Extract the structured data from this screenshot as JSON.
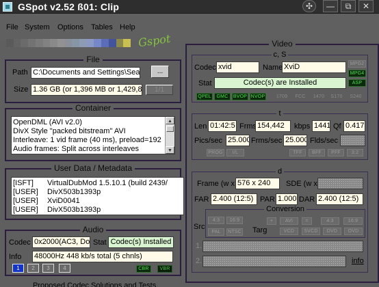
{
  "window": {
    "title": "GSpot v2.52 ß01: Clip",
    "help_glyph": "✣",
    "min_glyph": "—",
    "max_glyph": "⧉",
    "close_glyph": "✕"
  },
  "menu": {
    "file": "File",
    "system": "System",
    "options": "Options",
    "tables": "Tables",
    "help": "Help"
  },
  "colors": {
    "colorbar": [
      "#5a5a5a",
      "#636363",
      "#6b6b6b",
      "#737373",
      "#7a7a7a",
      "#828282",
      "#8a8a8a",
      "#929292",
      "#8a8f9a",
      "#8696a6",
      "#8e9bb5",
      "#8a98c3",
      "#7788c8",
      "#5b6db8",
      "#44549c",
      "#8c8a4a",
      "#c8c050"
    ],
    "logo": "#86c53f"
  },
  "logo": "Gspot",
  "file": {
    "title": "File",
    "path_label": "Path",
    "path_value": "C:\\Documents and Settings\\Sea",
    "browse_label": "...",
    "size_label": "Size",
    "size_value": "1.36 GB (or 1,396 MB or 1,429,85",
    "part_label": "1/1"
  },
  "container": {
    "title": "Container",
    "lines": [
      "OpenDML (AVI v2.0)",
      "DivX Style \"packed bitstream\" AVI",
      "Interleave: 1 vid frame (40 ms), preload=192",
      "Audio frames: Split across interleaves"
    ]
  },
  "metadata": {
    "title": "User Data / Metadata",
    "rows": [
      {
        "tag": "[ISFT]",
        "value": "VirtualDubMod 1.5.10.1 (build 2439/"
      },
      {
        "tag": "[USER]",
        "value": "DivX503b1393p"
      },
      {
        "tag": "[USER]",
        "value": "XviD0041"
      },
      {
        "tag": "[USER]",
        "value": "DivX503b1393p"
      }
    ]
  },
  "audio": {
    "title": "Audio",
    "codec_label": "Codec",
    "codec_value": "0x2000(AC3, Dol",
    "stat_label": "Stat",
    "stat_value": "Codec(s) Installed",
    "info_label": "Info",
    "info_value": "48000Hz  448 kb/s total (5 chnls)",
    "stream_buttons": [
      "1",
      "2",
      "3",
      "4"
    ],
    "cbr": "CBR",
    "vbr": "VBR"
  },
  "bottom_text": "Proposed Codec Solutions and Tests",
  "video": {
    "title": "Video",
    "cs": {
      "title": "c, S",
      "codec_label": "Codec",
      "codec_value": "xvid",
      "name_label": "Name",
      "name_value": "XviD",
      "stat_label": "Stat",
      "stat_value": "Codec(s) are Installed",
      "side_chips": [
        {
          "label": "MPG2",
          "on": false
        },
        {
          "label": "MPG4",
          "on": true
        },
        {
          "label": "ASP",
          "on": true
        }
      ],
      "chips": [
        {
          "label": "QPEL",
          "on": true
        },
        {
          "label": "GMC",
          "on": true
        },
        {
          "label": "BVOP",
          "on": true
        },
        {
          "label": "NVOP",
          "on": true
        },
        {
          "label": "1709",
          "on": false
        },
        {
          "label": "FCC",
          "on": false
        },
        {
          "label": "1470",
          "on": false
        },
        {
          "label": "S170",
          "on": false
        },
        {
          "label": "S240",
          "on": false
        }
      ]
    },
    "t": {
      "title": "t",
      "len_label": "Len",
      "len_value": "01:42:5",
      "frms_label": "Frms",
      "frms_value": "154,442",
      "kbps_label": "kbps",
      "kbps_value": "1441",
      "qf_label": "Qf",
      "qf_value": "0.417",
      "pics_label": "Pics/sec",
      "pics_value": "25.000",
      "frms_sec_label": "Frms/sec",
      "frms_sec_value": "25.000",
      "flds_label": "Flds/sec",
      "chips_left": [
        "PROG",
        "I/L"
      ],
      "chips_right": [
        "TFF",
        "BFF",
        "PFF",
        "3:2"
      ]
    },
    "d": {
      "title": "d",
      "frame_label": "Frame (w x",
      "frame_value": "576 x 240",
      "sde_label": "SDE (w x",
      "far_label": "FAR",
      "far_value": "2.400 (12:5)",
      "par_label": "PAR",
      "par_value": "1.000",
      "dar_label": "DAR",
      "dar_value": "2.400 (12:5)",
      "conversion": {
        "title": "Conversion",
        "src_label": "Src",
        "targ_label": "Targ",
        "src_chips": [
          "4:3",
          "16:9",
          "PAL",
          "NTSC"
        ],
        "targ_top": [
          "+",
          "AVI",
          "=",
          "4:3",
          "16:9"
        ],
        "targ_bottom": [
          "VCD",
          "SVCD",
          "DVD",
          "OVD"
        ]
      },
      "row1": "1.",
      "row2": "2.",
      "info_link": "info"
    }
  }
}
